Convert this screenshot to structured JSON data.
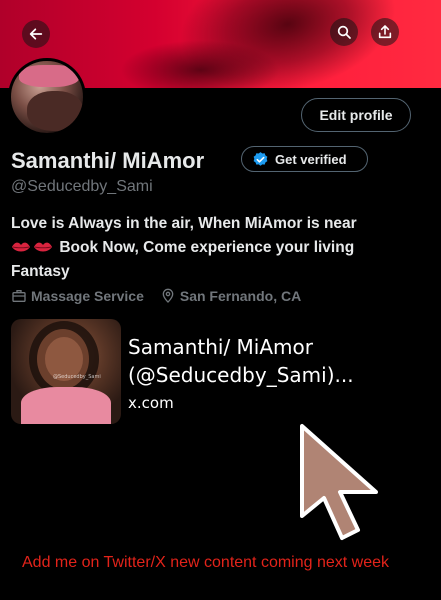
{
  "header": {
    "back_icon": "arrow-left-icon",
    "search_icon": "search-icon",
    "share_icon": "share-icon"
  },
  "profile": {
    "edit_profile_label": "Edit profile",
    "name": "Samanthi/ MiAmor",
    "get_verified_label": "Get verified",
    "handle": "@Seducedby_Sami",
    "bio_line1": "Love is Always in the air, When MiAmor is near",
    "bio_line2": "Book Now, Come experience your living",
    "bio_line3": "Fantasy",
    "category": "Massage Service",
    "location": "San Fernando, CA"
  },
  "link_card": {
    "title_line1": "Samanthi/ MiAmor",
    "title_line2": "(@Seducedby_Sami)...",
    "domain": "x.com",
    "thumbnail_watermark": "@Seducedby_Sami"
  },
  "caption": "Add me on Twitter/X new content coming next week",
  "colors": {
    "banner_red": "#ff1e3c",
    "verified_blue": "#1d9bf0",
    "caption_red": "#e2231a",
    "cursor_fill": "#b08474"
  }
}
